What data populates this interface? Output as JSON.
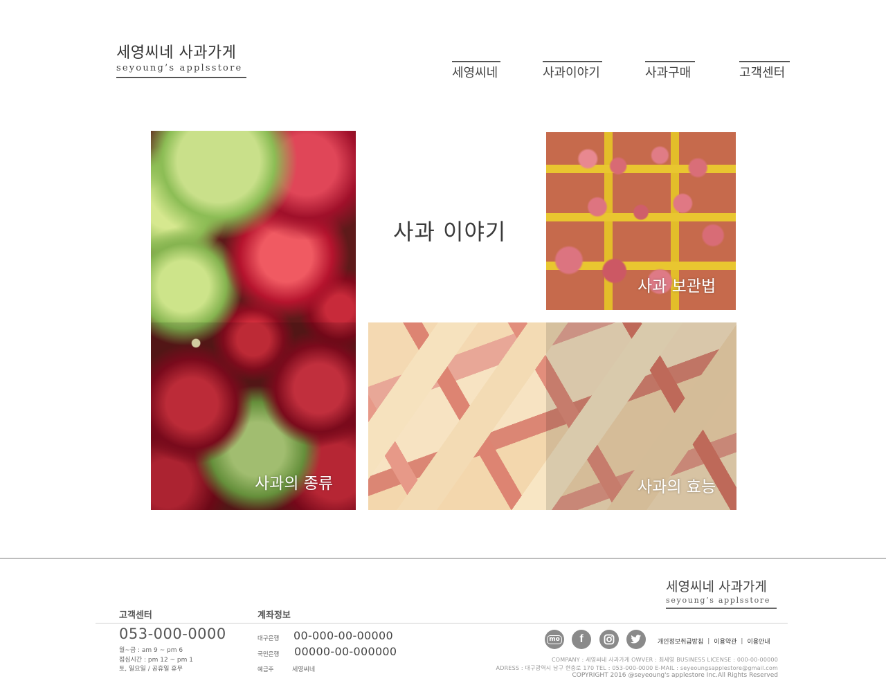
{
  "brand": {
    "name_ko": "세영씨네 사과가게",
    "name_en": "seyoung’s applsstore"
  },
  "nav": [
    "세영씨네",
    "사과이야기",
    "사과구매",
    "고객센터"
  ],
  "main": {
    "title": "사과 이야기",
    "tiles": {
      "types": "사과의 종류",
      "storage": "사과 보관법",
      "benefits": "사과의 효능"
    }
  },
  "footer": {
    "customer_center": {
      "heading": "고객센터",
      "phone": "053-000-0000",
      "hours": [
        "월~금 : am 9 ~ pm 6",
        "점심시간 : pm 12 ~ pm 1",
        "토, 일요일 / 공휴일 휴무"
      ]
    },
    "account": {
      "heading": "계좌정보",
      "banks": [
        {
          "label": "대구은행",
          "number": "00-000-00-00000"
        },
        {
          "label": "국민은행",
          "number": "00000-00-000000"
        }
      ],
      "holder_label": "예금주",
      "holder": "세영씨네"
    },
    "social_icons": [
      "mo-icon",
      "facebook-icon",
      "instagram-icon",
      "twitter-icon"
    ],
    "social_labels": {
      "mo": "mo",
      "facebook": "f"
    },
    "links": [
      "개인정보취급방침",
      "이용약관",
      "이용안내"
    ],
    "link_separator": "|",
    "info": [
      "COMPANY : 세영씨네 사과가게   OWVER : 최세영   BUSINESS LICENSE : 000-00-00000",
      "ADRESS : 대구광역시 남구 현충로 170   TEL : 053-000-0000   E-MAIL : seyeoungsapplestore@gmail.com"
    ],
    "copyright": "COPYRIGHT 2016 @seyeoung's applestore Inc.All Rights Reserved"
  },
  "colors": {
    "text_dark": "#333333",
    "rule_line": "#bdbdbd",
    "social_icon_bg": "#8a8a8a"
  }
}
